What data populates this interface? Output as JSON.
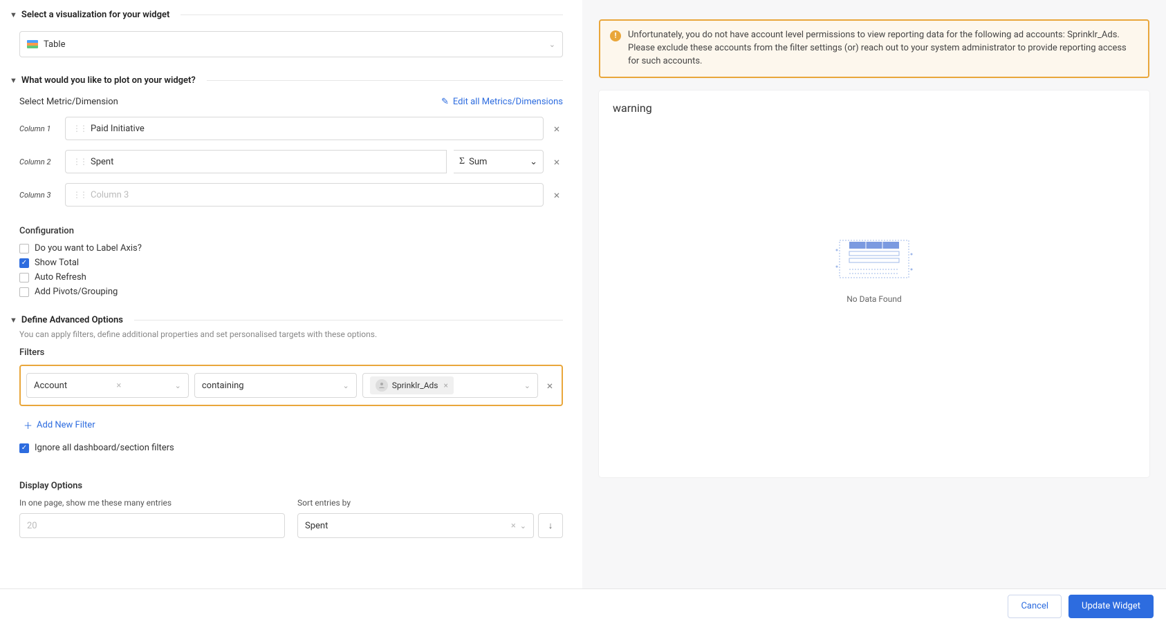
{
  "sections": {
    "viz": {
      "title": "Select a visualization for your widget",
      "selected": "Table"
    },
    "plot": {
      "title": "What would you like to plot on your widget?",
      "metric_label": "Select Metric/Dimension",
      "edit_link": "Edit all Metrics/Dimensions",
      "columns": [
        {
          "label": "Column 1",
          "value": "Paid Initiative",
          "agg": null
        },
        {
          "label": "Column 2",
          "value": "Spent",
          "agg": "Sum"
        },
        {
          "label": "Column 3",
          "value": "",
          "placeholder": "Column 3",
          "agg": null
        }
      ],
      "config_title": "Configuration",
      "config_opts": [
        {
          "label": "Do you want to Label Axis?",
          "checked": false
        },
        {
          "label": "Show Total",
          "checked": true
        },
        {
          "label": "Auto Refresh",
          "checked": false
        },
        {
          "label": "Add Pivots/Grouping",
          "checked": false
        }
      ]
    },
    "advanced": {
      "title": "Define Advanced Options",
      "subtitle": "You can apply filters, define additional properties and set personalised targets with these options.",
      "filters_label": "Filters",
      "filter_row": {
        "field": "Account",
        "op": "containing",
        "value": "Sprinklr_Ads"
      },
      "add_filter": "Add New Filter",
      "ignore_label": "Ignore all dashboard/section filters",
      "ignore_checked": true,
      "display_title": "Display Options",
      "entries_label": "In one page, show me these many entries",
      "entries_placeholder": "20",
      "sort_label": "Sort entries by",
      "sort_value": "Spent"
    }
  },
  "warning_text": "Unfortunately, you do not have account level permissions to view reporting data for the following ad accounts: Sprinklr_Ads. Please exclude these accounts from the filter settings (or) reach out to your system administrator to provide reporting access for such accounts.",
  "preview_title": "warning",
  "empty_text": "No Data Found",
  "footer": {
    "cancel": "Cancel",
    "update": "Update Widget"
  }
}
